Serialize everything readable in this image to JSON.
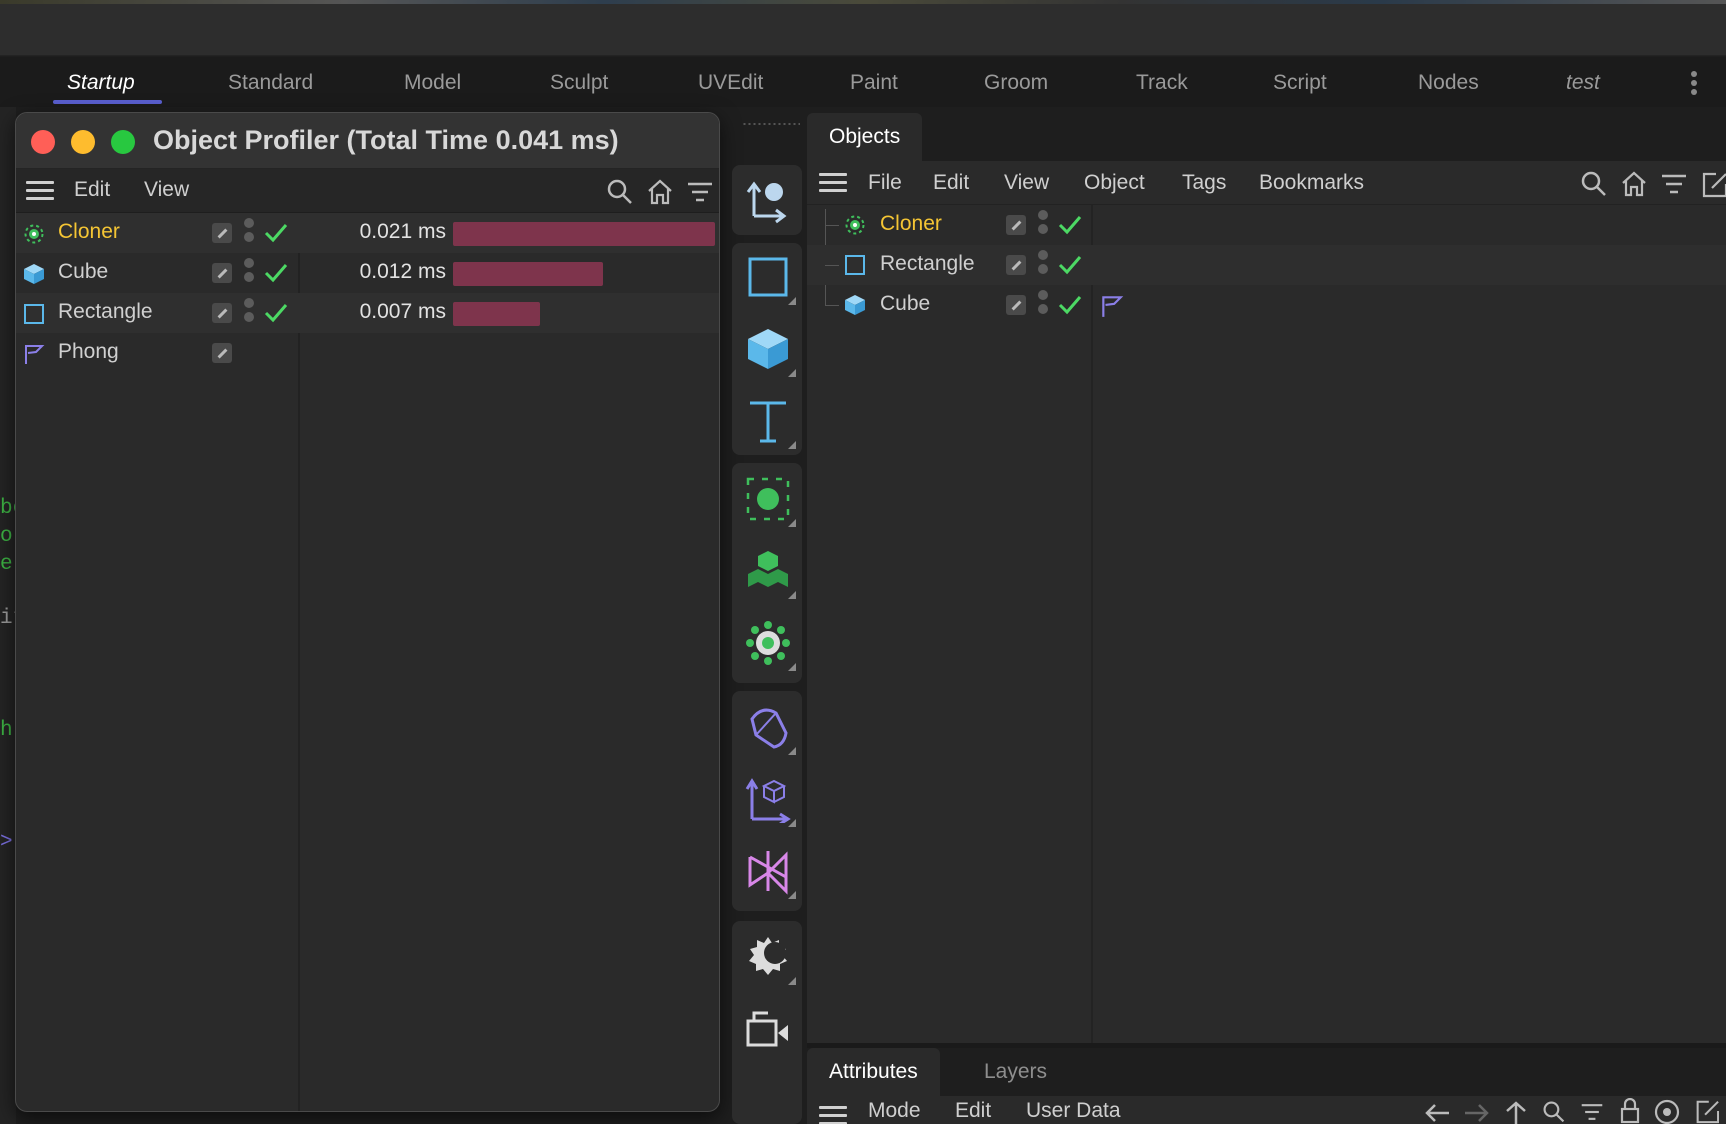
{
  "layout_tabs": [
    "Startup",
    "Standard",
    "Model",
    "Sculpt",
    "UVEdit",
    "Paint",
    "Groom",
    "Track",
    "Script",
    "Nodes",
    "test"
  ],
  "active_layout": "Startup",
  "colors": {
    "accent": "#5a5fd0",
    "highlight_text": "#f4c534",
    "bar": "#7e344c",
    "check": "#4cd964",
    "close": "#ff5f57",
    "minimize": "#febc2e",
    "zoom": "#28c840",
    "tool_blue": "#5bb8ea",
    "tool_green": "#3fbf5c",
    "tool_purple": "#8b7fe8",
    "tool_pink": "#d887e8"
  },
  "profiler": {
    "title": "Object Profiler (Total Time 0.041 ms)",
    "menu": {
      "edit": "Edit",
      "view": "View"
    },
    "rows": [
      {
        "name": "Cloner",
        "icon": "cloner-icon",
        "time": "0.021 ms",
        "share": 0.021,
        "enabled": true
      },
      {
        "name": "Cube",
        "icon": "cube-icon",
        "time": "0.012 ms",
        "share": 0.012,
        "enabled": true
      },
      {
        "name": "Rectangle",
        "icon": "rectangle-icon",
        "time": "0.007 ms",
        "share": 0.007,
        "enabled": true
      },
      {
        "name": "Phong",
        "icon": "phong-tag-icon",
        "time": "",
        "share": 0,
        "enabled": false
      }
    ]
  },
  "objects": {
    "tab": "Objects",
    "menu": {
      "file": "File",
      "edit": "Edit",
      "view": "View",
      "object": "Object",
      "tags": "Tags",
      "bookmarks": "Bookmarks"
    },
    "rows": [
      {
        "name": "Cloner",
        "icon": "cloner-icon",
        "tags": []
      },
      {
        "name": "Rectangle",
        "icon": "rectangle-icon",
        "tags": []
      },
      {
        "name": "Cube",
        "icon": "cube-icon",
        "tags": [
          "phong-tag-icon"
        ]
      }
    ]
  },
  "attributes": {
    "tabs": [
      "Attributes",
      "Layers"
    ],
    "menu": {
      "mode": "Mode",
      "edit": "Edit",
      "user_data": "User Data"
    }
  },
  "toolbar_tools": [
    "move-icon",
    "rectangle-spline-icon",
    "cube-primitive-icon",
    "text-spline-icon",
    "cloner-icon",
    "voronoi-icon",
    "mograph-effector-icon",
    "deformer-icon",
    "coordinate-system-icon",
    "field-icon",
    "sky-icon",
    "camera-icon"
  ],
  "background_code": [
    "be",
    "o",
    "er",
    "it",
    "h",
    ">"
  ]
}
